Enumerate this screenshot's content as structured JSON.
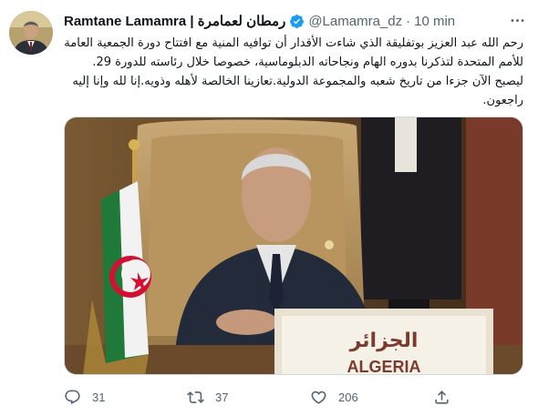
{
  "tweet": {
    "author": {
      "display_name": "Ramtane Lamamra | رمطان لعمامرة",
      "handle": "@Lamamra_dz",
      "verified": true,
      "avatar": "profile-photo"
    },
    "time": "10 min",
    "separator": "·",
    "text": "رحم الله عبد العزيز بوتفليقة الذي شاءت الأقدار أن توافيه المنية مع افتتاح دورة الجمعية العامة للأمم المتحدة لتذكرنا بدوره الهام ونجاحاته الدبلوماسية، خصوصا خلال رئاسته للدورة 29. ليصبح الآن جزءا من تاريخ شعبه والمجموعة الدولية.تعازينا الخالصة لأهله وذويه.إنا لله وإنا إليه راجعون.",
    "media": {
      "placard_arabic": "الجزائر",
      "placard_latin": "ALGERIA"
    },
    "actions": {
      "reply_count": "31",
      "retweet_count": "37",
      "like_count": "206"
    }
  },
  "colors": {
    "text_primary": "#0f1419",
    "text_secondary": "#536471",
    "verified_blue": "#1d9bf0",
    "border": "#cfd9de"
  },
  "icons": [
    "verified-badge-icon",
    "more-icon",
    "reply-icon",
    "retweet-icon",
    "like-icon",
    "share-icon"
  ]
}
